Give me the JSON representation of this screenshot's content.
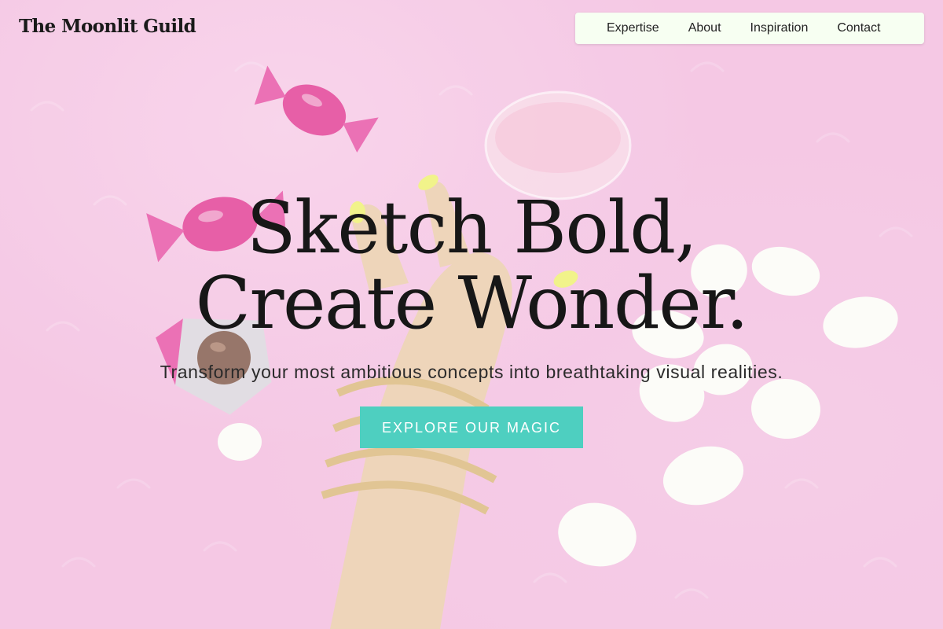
{
  "header": {
    "brand": "The Moonlit Guild",
    "nav": [
      {
        "label": "Expertise"
      },
      {
        "label": "About"
      },
      {
        "label": "Inspiration"
      },
      {
        "label": "Contact"
      }
    ]
  },
  "hero": {
    "title_line1": "Sketch Bold,",
    "title_line2": "Create Wonder.",
    "subtitle": "Transform your most ambitious concepts into breathtaking visual realities.",
    "cta_label": "EXPLORE OUR MAGIC",
    "background_image": "pink-fur-rug-candies-glass-hand-petals"
  },
  "colors": {
    "nav_background": "#f7fff2",
    "cta_background": "#4ecfc0",
    "cta_text": "#ffffff",
    "background_pink": "#f2b9dd",
    "text_dark": "#171717"
  }
}
